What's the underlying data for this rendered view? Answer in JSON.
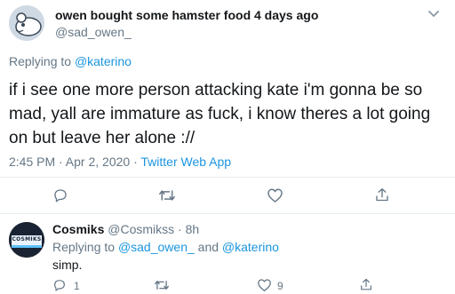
{
  "tweet": {
    "display_name": "owen bought some hamster food 4 days ago",
    "handle": "@sad_owen_",
    "replying_prefix": "Replying to ",
    "replying_to": "@katerino",
    "text": "if i see one more person attacking kate i'm gonna be so mad, yall are immature as fuck, i know theres a lot going on but leave her alone ://",
    "time": "2:45 PM · Apr 2, 2020 · ",
    "source": "Twitter Web App"
  },
  "reply": {
    "display_name": "Cosmiks",
    "handle": "@Cosmikss",
    "separator": " · ",
    "age": "8h",
    "replying_prefix": "Replying to ",
    "replying_to_1": "@sad_owen_",
    "replying_and": " and ",
    "replying_to_2": "@katerino",
    "text": "simp.",
    "reply_count": "1",
    "like_count": "9",
    "avatar_text": "COSMIKS"
  },
  "icons": [
    "reply-icon",
    "retweet-icon",
    "like-icon",
    "share-icon",
    "chevron-down-icon"
  ],
  "colors": {
    "link": "#1b95e0",
    "muted": "#657786",
    "divider": "#e6ecf0"
  }
}
